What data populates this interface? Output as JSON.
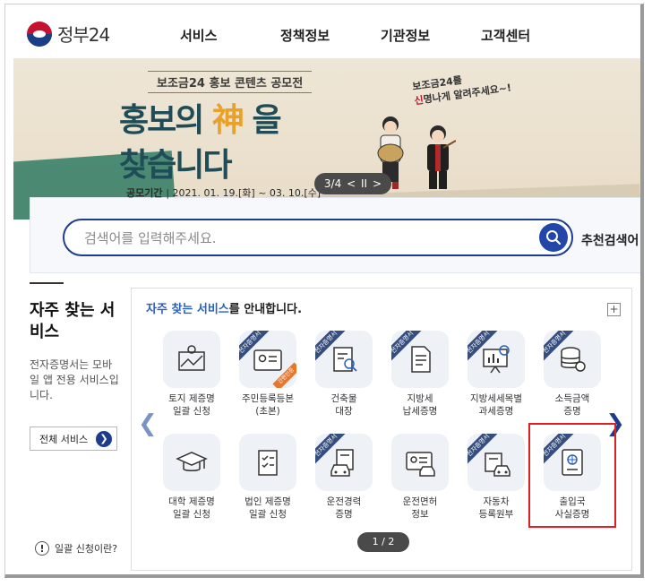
{
  "header": {
    "logo_text": "정부24",
    "nav": [
      "서비스",
      "정책정보",
      "기관정보",
      "고객센터"
    ]
  },
  "banner": {
    "subtitle": "보조금24 홍보 콘텐츠 공모전",
    "title_line1_pre": "홍보의 ",
    "title_line1_god": "神",
    "title_line1_post": " 을",
    "title_line2": "찾습니다",
    "period_label": "공모기간",
    "period_value": "| 2021. 01. 19.[화] ~ 03. 10.[수]",
    "speech_line1": "보조금24를",
    "speech_em": "신",
    "speech_line2": "명나게 알려주세요~!",
    "slide_counter": "3/4",
    "prev_symbol": "<",
    "pause_symbol": "II",
    "next_symbol": ">"
  },
  "search": {
    "placeholder": "검색어를 입력해주세요.",
    "recommended_label": "추천검색어"
  },
  "left": {
    "title": "자주 찾는 서비스",
    "description": "전자증명서는 모바일 앱 전용 서비스입니다.",
    "all_services_label": "전체 서비스",
    "help_label": "일괄 신청이란?"
  },
  "panel": {
    "title_highlight": "자주 찾는 서비스",
    "title_rest": "를 안내합니다.",
    "plus": "+",
    "prev": "❮",
    "next": "❯",
    "pager": "1 / 2",
    "ribbon_text": "전자증명서",
    "badge_text": "간편인증",
    "services_row1": [
      {
        "label1": "토지 제증명",
        "label2": "일괄 신청",
        "icon": "map-icon",
        "ribbon": false
      },
      {
        "label1": "주민등록등본",
        "label2": "(초본)",
        "icon": "id-card-icon",
        "ribbon": true
      },
      {
        "label1": "건축물",
        "label2": "대장",
        "icon": "document-search-icon",
        "ribbon": true
      },
      {
        "label1": "지방세",
        "label2": "납세증명",
        "icon": "document-icon",
        "ribbon": true
      },
      {
        "label1": "지방세세목별",
        "label2": "과세증명",
        "icon": "presentation-icon",
        "ribbon": true
      },
      {
        "label1": "소득금액",
        "label2": "증명",
        "icon": "coins-icon",
        "ribbon": true
      }
    ],
    "services_row2": [
      {
        "label1": "대학 제증명",
        "label2": "일괄 신청",
        "icon": "graduation-cap-icon",
        "ribbon": false
      },
      {
        "label1": "법인 제증명",
        "label2": "일괄 신청",
        "icon": "checklist-icon",
        "ribbon": false
      },
      {
        "label1": "운전경력",
        "label2": "증명",
        "icon": "car-document-icon",
        "ribbon": true
      },
      {
        "label1": "운전면허",
        "label2": "정보",
        "icon": "license-icon",
        "ribbon": false
      },
      {
        "label1": "자동차",
        "label2": "등록원부",
        "icon": "car-register-icon",
        "ribbon": true
      },
      {
        "label1": "출입국",
        "label2": "사실증명",
        "icon": "passport-icon",
        "ribbon": true
      }
    ]
  }
}
